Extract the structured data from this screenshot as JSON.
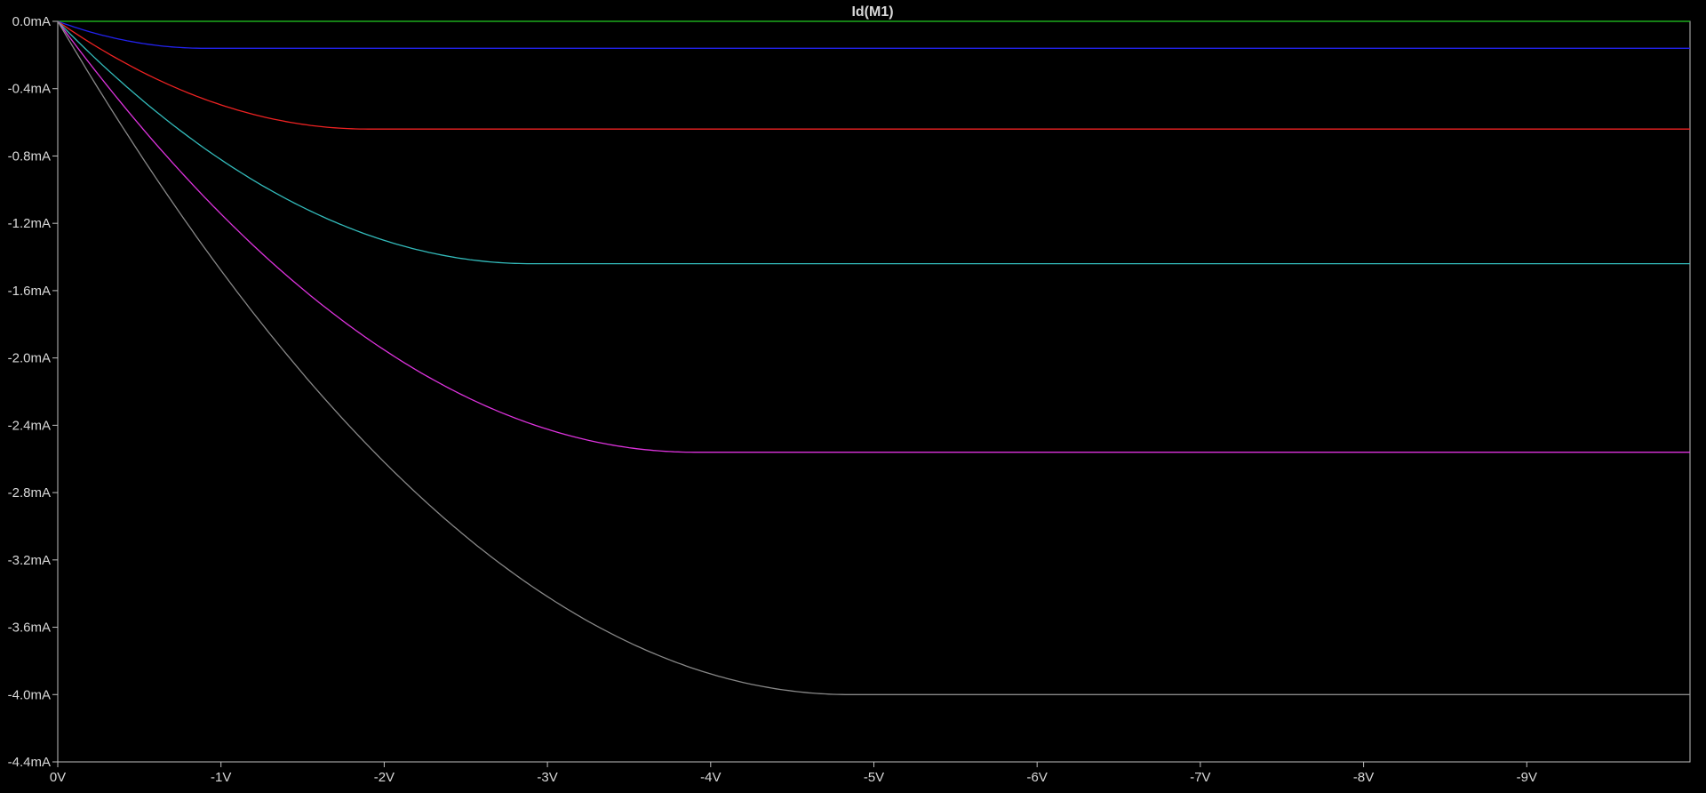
{
  "window": {
    "background": "#000000",
    "axis_color": "#c0c0c0",
    "label_color": "#d8d8d8"
  },
  "chart_data": {
    "type": "line",
    "title": "Id(M1)",
    "title_color": "#22ee22",
    "xlabel": "",
    "ylabel": "",
    "xlim": [
      0,
      -10
    ],
    "ylim": [
      -4.4,
      0.0
    ],
    "x_ticks": [
      0,
      -1,
      -2,
      -3,
      -4,
      -5,
      -6,
      -7,
      -8,
      -9
    ],
    "x_tick_labels": [
      "0V",
      "-1V",
      "-2V",
      "-3V",
      "-4V",
      "-5V",
      "-6V",
      "-7V",
      "-8V",
      "-9V"
    ],
    "y_ticks": [
      0.0,
      -0.4,
      -0.8,
      -1.2,
      -1.6,
      -2.0,
      -2.4,
      -2.8,
      -3.2,
      -3.6,
      -4.0,
      -4.4
    ],
    "y_tick_labels": [
      "0.0mA",
      "-0.4mA",
      "-0.8mA",
      "-1.2mA",
      "-1.6mA",
      "-2.0mA",
      "-2.4mA",
      "-2.8mA",
      "-3.2mA",
      "-3.6mA",
      "-4.0mA",
      "-4.4mA"
    ],
    "grid": false,
    "legend": "none",
    "series": [
      {
        "color": "#22cc22",
        "vsat": 0.0,
        "isat": 0.0
      },
      {
        "color": "#2222ee",
        "vsat": -0.9,
        "isat": -0.16
      },
      {
        "color": "#ee2222",
        "vsat": -1.9,
        "isat": -0.64
      },
      {
        "color": "#33bbbb",
        "vsat": -2.9,
        "isat": -1.44
      },
      {
        "color": "#dd33dd",
        "vsat": -3.9,
        "isat": -2.56
      },
      {
        "color": "#888888",
        "vsat": -4.85,
        "isat": -4.0
      }
    ]
  }
}
